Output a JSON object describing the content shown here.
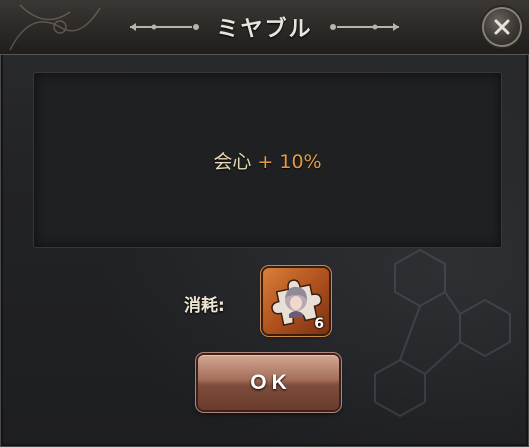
{
  "dialog": {
    "title": "ミヤブル",
    "close_icon": "close-icon"
  },
  "effect": {
    "stat_name": "会心",
    "stat_value": "+ 10%"
  },
  "cost": {
    "label": "消耗:",
    "item_icon": "puzzle-portrait-icon",
    "item_count": "6"
  },
  "actions": {
    "ok_label": "OK"
  },
  "colors": {
    "stat_value": "#e29a46",
    "stat_name": "#e6d8b8",
    "item_frame": "#c8672a",
    "ok_button": "#a46e5a"
  }
}
